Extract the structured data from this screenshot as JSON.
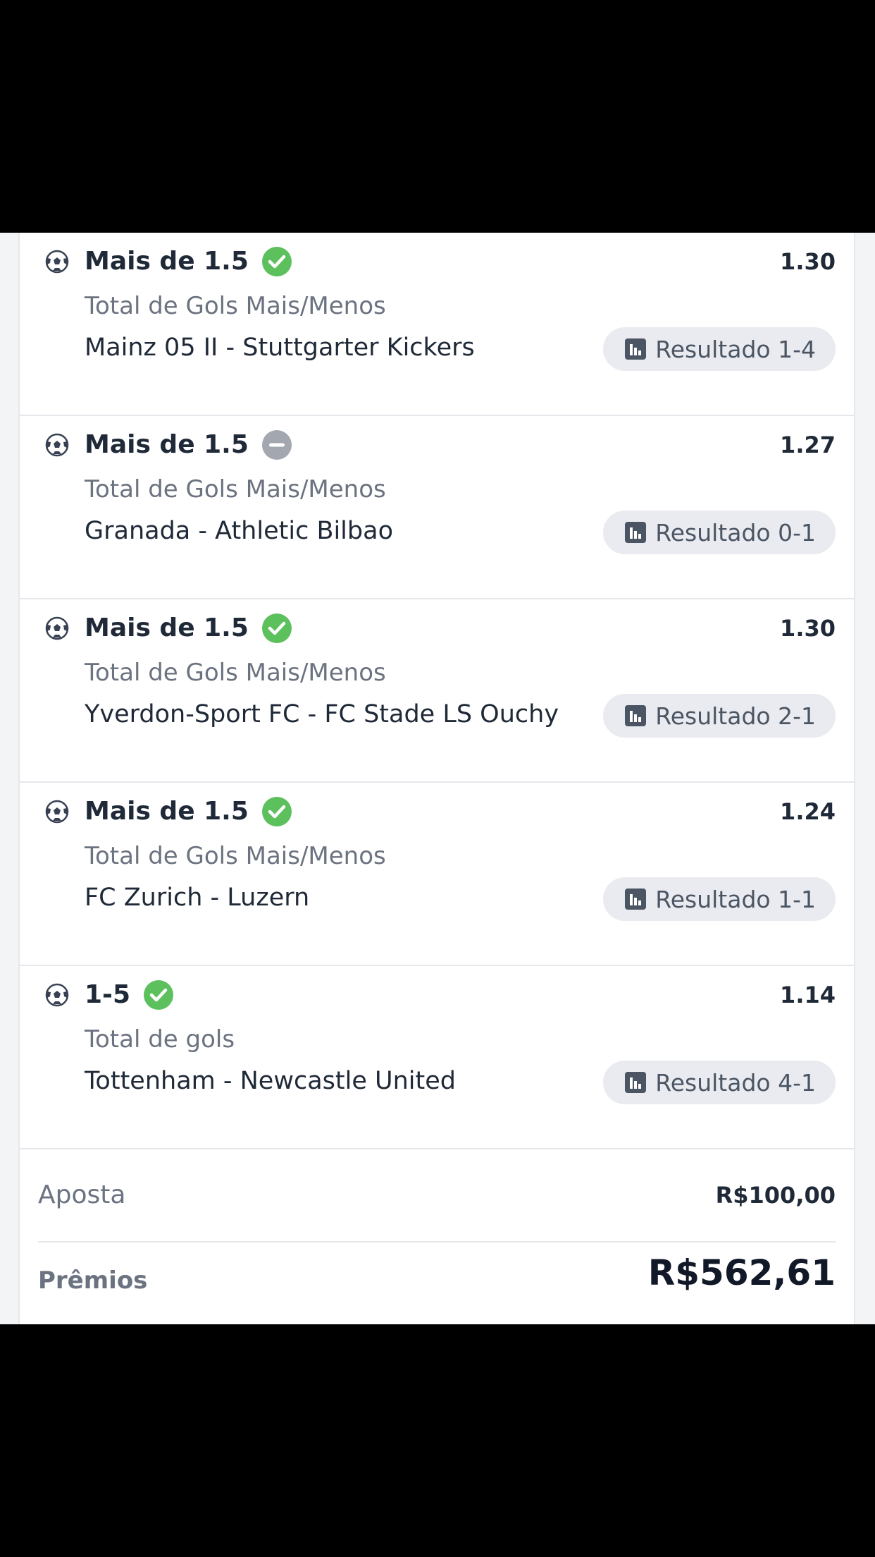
{
  "bets": [
    {
      "selection": "Mais de 1.5",
      "status": "won",
      "odds": "1.30",
      "market": "Total de Gols Mais/Menos",
      "match": "Mainz 05 II - Stuttgarter Kickers",
      "result": "Resultado 1-4"
    },
    {
      "selection": "Mais de 1.5",
      "status": "void",
      "odds": "1.27",
      "market": "Total de Gols Mais/Menos",
      "match": "Granada - Athletic Bilbao",
      "result": "Resultado 0-1"
    },
    {
      "selection": "Mais de 1.5",
      "status": "won",
      "odds": "1.30",
      "market": "Total de Gols Mais/Menos",
      "match": "Yverdon-Sport FC - FC Stade LS Ouchy",
      "result": "Resultado 2-1"
    },
    {
      "selection": "Mais de 1.5",
      "status": "won",
      "odds": "1.24",
      "market": "Total de Gols Mais/Menos",
      "match": "FC Zurich - Luzern",
      "result": "Resultado 1-1"
    },
    {
      "selection": "1-5",
      "status": "won",
      "odds": "1.14",
      "market": "Total de gols",
      "match": "Tottenham - Newcastle United",
      "result": "Resultado 4-1"
    }
  ],
  "summary": {
    "stake_label": "Aposta",
    "stake_value": "R$100,00",
    "prize_label": "Prêmios",
    "prize_value": "R$562,61"
  },
  "colors": {
    "won": "#5cc05c",
    "void": "#a3a8b0",
    "pill_bg": "#e9ebf0"
  },
  "icons": {
    "sport": "soccer-ball-icon",
    "won": "check-circle-icon",
    "void": "minus-circle-icon",
    "result": "bar-chart-icon"
  }
}
